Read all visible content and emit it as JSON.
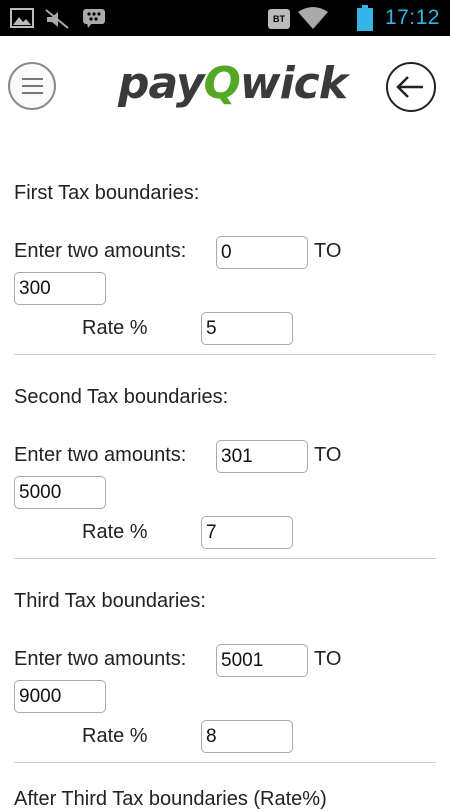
{
  "status_bar": {
    "time": "17:12",
    "icons": [
      "image-icon",
      "muted-icon",
      "bbm-icon",
      "bt-icon",
      "wifi-icon",
      "battery-icon"
    ],
    "bt_label": "BT",
    "time_color": "#33b5e5"
  },
  "header": {
    "logo_part1": "pay",
    "logo_q": "Q",
    "logo_part2": "wick",
    "brand_green": "#55a826"
  },
  "sections": [
    {
      "title": "First Tax boundaries:",
      "amounts_label": "Enter two amounts:",
      "from": "0",
      "to_label": "TO",
      "to": "300",
      "rate_label": "Rate %",
      "rate": "5"
    },
    {
      "title": "Second Tax boundaries:",
      "amounts_label": "Enter two amounts:",
      "from": "301",
      "to_label": "TO",
      "to": "5000",
      "rate_label": "Rate %",
      "rate": "7"
    },
    {
      "title": "Third Tax boundaries:",
      "amounts_label": "Enter two amounts:",
      "from": "5001",
      "to_label": "TO",
      "to": "9000",
      "rate_label": "Rate %",
      "rate": "8"
    }
  ],
  "partial_heading": "After Third Tax boundaries (Rate%)"
}
